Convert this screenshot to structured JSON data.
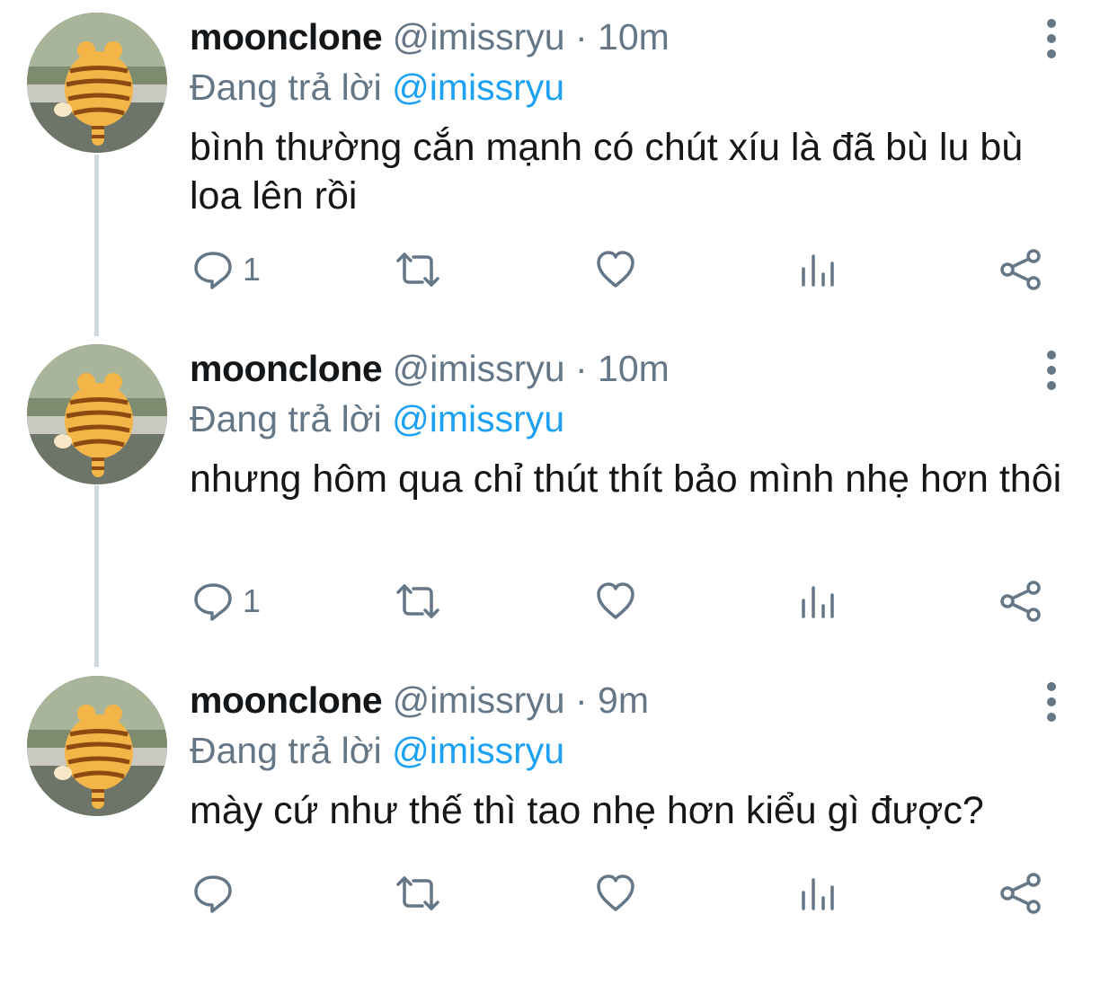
{
  "colors": {
    "text": "#14171a",
    "secondary": "#657786",
    "link": "#1da1f2",
    "thread_line": "#cfd9de"
  },
  "tweets": [
    {
      "display_name": "moonclone",
      "handle": "@imissryu",
      "separator": "·",
      "time": "10m",
      "reply_prefix": "Đang trả lời",
      "reply_to": "@imissryu",
      "text": "bình thường cắn mạnh có chút xíu là đã bù lu bù loa lên rồi",
      "reply_count": "1",
      "icons": [
        "more-vertical-icon",
        "reply-icon",
        "retweet-icon",
        "like-icon",
        "analytics-icon",
        "share-icon"
      ]
    },
    {
      "display_name": "moonclone",
      "handle": "@imissryu",
      "separator": "·",
      "time": "10m",
      "reply_prefix": "Đang trả lời",
      "reply_to": "@imissryu",
      "text": "nhưng hôm qua chỉ thút thít bảo mình nhẹ hơn thôi",
      "reply_count": "1",
      "icons": [
        "more-vertical-icon",
        "reply-icon",
        "retweet-icon",
        "like-icon",
        "analytics-icon",
        "share-icon"
      ]
    },
    {
      "display_name": "moonclone",
      "handle": "@imissryu",
      "separator": "·",
      "time": "9m",
      "reply_prefix": "Đang trả lời",
      "reply_to": "@imissryu",
      "text": "mày cứ như thế thì tao nhẹ hơn kiểu gì được?",
      "reply_count": "",
      "icons": [
        "more-vertical-icon",
        "reply-icon",
        "retweet-icon",
        "like-icon",
        "analytics-icon",
        "share-icon"
      ]
    }
  ]
}
